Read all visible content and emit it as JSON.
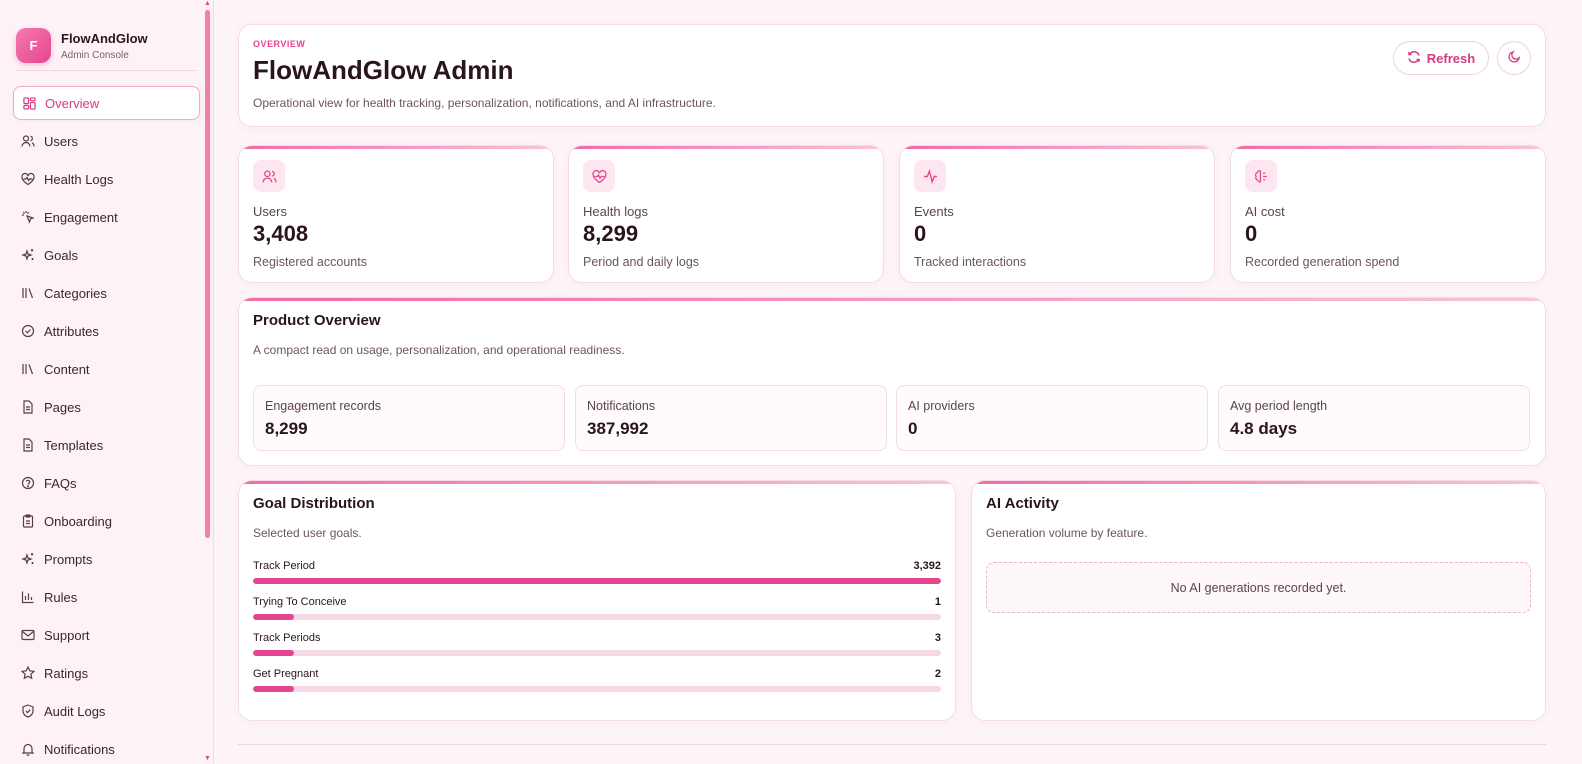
{
  "brand": {
    "logo_letter": "F",
    "name": "FlowAndGlow",
    "subtitle": "Admin Console"
  },
  "nav": [
    {
      "label": "Overview",
      "icon": "grid-icon",
      "active": true
    },
    {
      "label": "Users",
      "icon": "users-icon"
    },
    {
      "label": "Health Logs",
      "icon": "heart-pulse-icon"
    },
    {
      "label": "Engagement",
      "icon": "sparkle-click-icon"
    },
    {
      "label": "Goals",
      "icon": "sparkles-icon"
    },
    {
      "label": "Categories",
      "icon": "library-icon"
    },
    {
      "label": "Attributes",
      "icon": "check-circle-icon"
    },
    {
      "label": "Content",
      "icon": "library-icon"
    },
    {
      "label": "Pages",
      "icon": "document-icon"
    },
    {
      "label": "Templates",
      "icon": "document-icon"
    },
    {
      "label": "FAQs",
      "icon": "help-circle-icon"
    },
    {
      "label": "Onboarding",
      "icon": "clipboard-icon"
    },
    {
      "label": "Prompts",
      "icon": "sparkles-icon"
    },
    {
      "label": "Rules",
      "icon": "bar-chart-icon"
    },
    {
      "label": "Support",
      "icon": "mail-icon"
    },
    {
      "label": "Ratings",
      "icon": "star-icon"
    },
    {
      "label": "Audit Logs",
      "icon": "shield-check-icon"
    },
    {
      "label": "Notifications",
      "icon": "bell-icon"
    }
  ],
  "header": {
    "eyebrow": "OVERVIEW",
    "title": "FlowAndGlow Admin",
    "description": "Operational view for health tracking, personalization, notifications, and AI infrastructure.",
    "refresh_label": "Refresh"
  },
  "stats": [
    {
      "label": "Users",
      "value": "3,408",
      "sub": "Registered accounts",
      "icon": "users-icon"
    },
    {
      "label": "Health logs",
      "value": "8,299",
      "sub": "Period and daily logs",
      "icon": "heart-pulse-icon"
    },
    {
      "label": "Events",
      "value": "0",
      "sub": "Tracked interactions",
      "icon": "activity-icon"
    },
    {
      "label": "AI cost",
      "value": "0",
      "sub": "Recorded generation spend",
      "icon": "brain-icon"
    }
  ],
  "product_overview": {
    "title": "Product Overview",
    "description": "A compact read on usage, personalization, and operational readiness.",
    "metrics": [
      {
        "label": "Engagement records",
        "value": "8,299"
      },
      {
        "label": "Notifications",
        "value": "387,992"
      },
      {
        "label": "AI providers",
        "value": "0"
      },
      {
        "label": "Avg period length",
        "value": "4.8 days"
      }
    ]
  },
  "goal_distribution": {
    "title": "Goal Distribution",
    "description": "Selected user goals.",
    "goals": [
      {
        "label": "Track Period",
        "value": "3,392",
        "fraction": 1.0
      },
      {
        "label": "Trying To Conceive",
        "value": "1",
        "fraction": 0.06
      },
      {
        "label": "Track Periods",
        "value": "3",
        "fraction": 0.06
      },
      {
        "label": "Get Pregnant",
        "value": "2",
        "fraction": 0.06
      }
    ]
  },
  "ai_activity": {
    "title": "AI Activity",
    "description": "Generation volume by feature.",
    "empty_text": "No AI generations recorded yet."
  },
  "colors": {
    "accent": "#e6458f",
    "accent_soft": "#fde6f0",
    "track": "#f7d8e6"
  }
}
